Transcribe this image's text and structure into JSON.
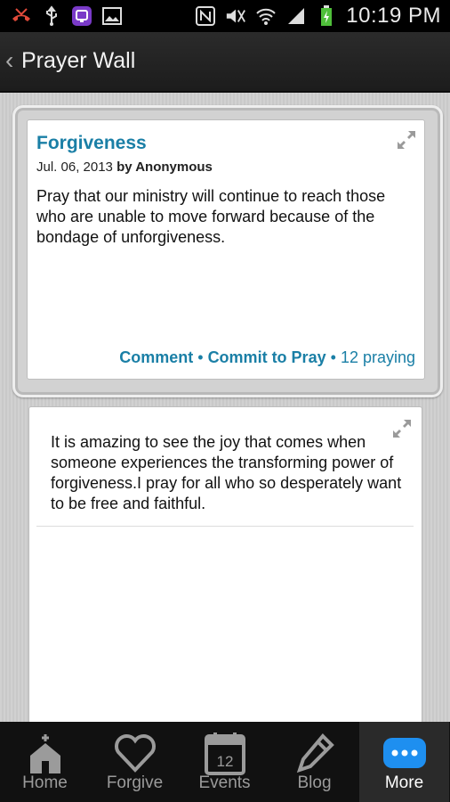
{
  "status_bar": {
    "time": "10:19 PM",
    "left_icons": [
      "missed-call-icon",
      "usb-icon",
      "app-notification-icon",
      "image-icon"
    ],
    "right_icons": [
      "nfc-icon",
      "mute-icon",
      "wifi-icon",
      "signal-icon",
      "battery-icon"
    ]
  },
  "header": {
    "title": "Prayer Wall"
  },
  "prayer": {
    "title": "Forgiveness",
    "date": "Jul. 06, 2013",
    "author": "by Anonymous",
    "body": "Pray that our ministry will continue to reach those who are unable to move forward because of the bondage of unforgiveness.",
    "comment_label": "Comment",
    "commit_label": "Commit to Pray",
    "praying_count": "12 praying",
    "separator": "•"
  },
  "comment": {
    "text": "It is amazing to see the joy that comes when someone experiences the transforming power of forgiveness.I pray for all who so desperately want to be free and faithful."
  },
  "tabs": [
    {
      "label": "Home",
      "icon": "church-icon"
    },
    {
      "label": "Forgive",
      "icon": "heart-icon"
    },
    {
      "label": "Events",
      "icon": "calendar-icon",
      "badge": "12"
    },
    {
      "label": "Blog",
      "icon": "pencil-icon"
    },
    {
      "label": "More",
      "icon": "more-dots-icon",
      "active": true
    }
  ],
  "colors": {
    "accent": "#1a7fa6",
    "more_icon": "#1e8ff0"
  }
}
